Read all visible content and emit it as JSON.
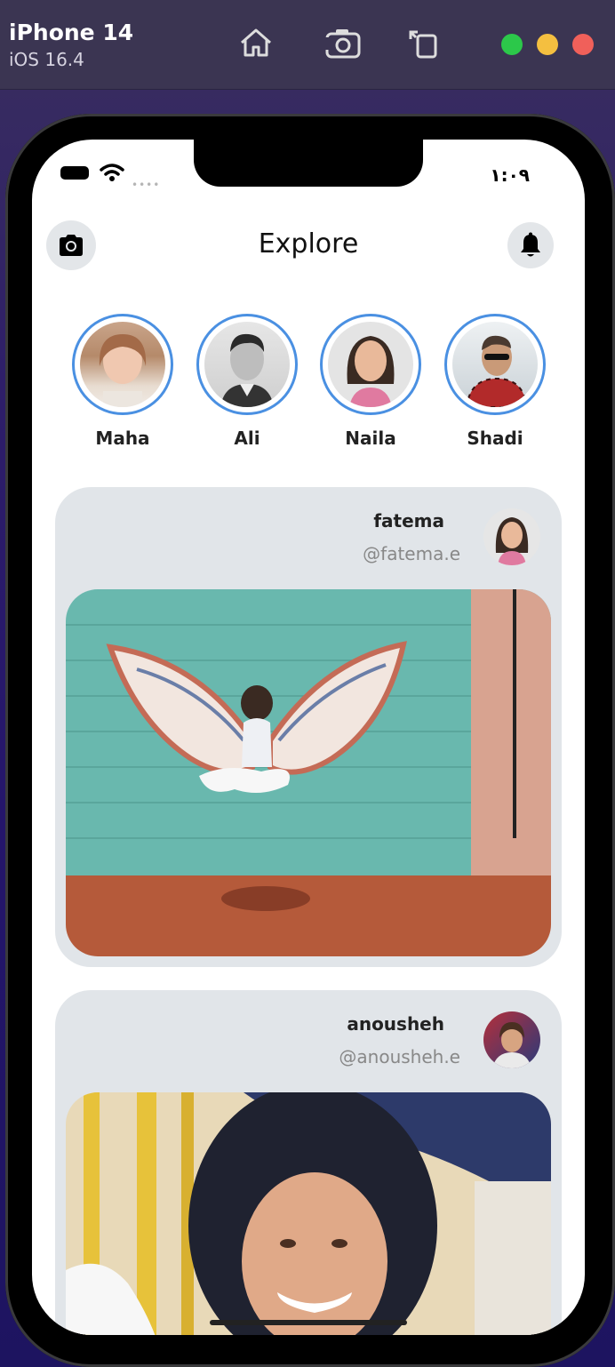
{
  "simulator": {
    "device_name": "iPhone 14",
    "os_version": "iOS 16.4",
    "icons": [
      "home-icon",
      "screenshot-icon",
      "rotate-icon"
    ],
    "traffic_lights": [
      "#2cc84a",
      "#f4bf40",
      "#f0605a"
    ]
  },
  "status_bar": {
    "time": "١:٠٩"
  },
  "header": {
    "title": "Explore",
    "left_icon": "camera-icon",
    "right_icon": "bell-icon"
  },
  "stories": [
    {
      "name": "Maha"
    },
    {
      "name": "Ali"
    },
    {
      "name": "Naila"
    },
    {
      "name": "Shadi"
    }
  ],
  "posts": [
    {
      "name": "fatema",
      "handle": "@fatema.e"
    },
    {
      "name": "anousheh",
      "handle": "@anousheh.e"
    }
  ],
  "colors": {
    "story_ring": "#4a90e2",
    "card_bg": "#e1e5e9"
  }
}
